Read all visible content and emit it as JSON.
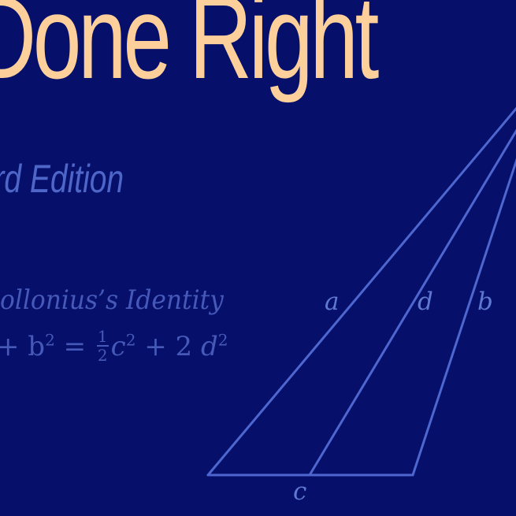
{
  "cover": {
    "title": "Done Right",
    "edition": "hird Edition",
    "identity": {
      "heading": "pollonius’s Identity",
      "lead": "+ b",
      "sup_b": "2",
      "eq": " = ",
      "frac_num": "1",
      "frac_den": "2",
      "c": "c",
      "sup_c": "2",
      "plus": " + 2 ",
      "d": "d",
      "sup_d": "2"
    },
    "diagram": {
      "labels": {
        "a": "a",
        "d": "d",
        "b": "b",
        "c": "c"
      }
    }
  },
  "colors": {
    "background": "#06106b",
    "title": "#fdd09b",
    "subtitle": "#4d66c8",
    "line": "#4e66cf"
  }
}
